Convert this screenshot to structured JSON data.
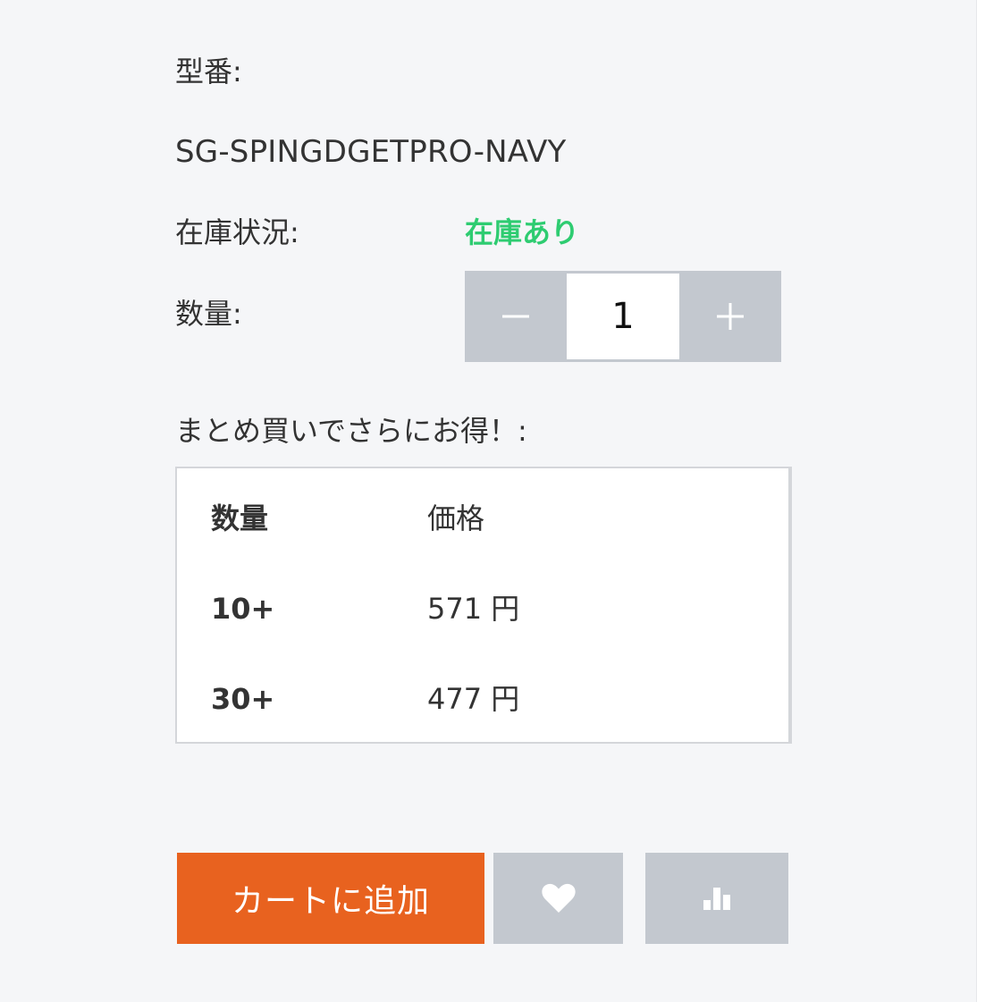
{
  "product": {
    "model_label": "型番:",
    "model_value": "SG-SPINGDGETPRO-NAVY",
    "stock_label": "在庫状況:",
    "stock_value": "在庫あり",
    "quantity_label": "数量:",
    "quantity_value": "1"
  },
  "bulk": {
    "title": "まとめ買いでさらにお得！:",
    "header": {
      "qty": "数量",
      "price": "価格"
    },
    "rows": [
      {
        "qty": "10+",
        "price": "571 円"
      },
      {
        "qty": "30+",
        "price": "477 円"
      }
    ]
  },
  "actions": {
    "add_to_cart_label": "カートに追加",
    "wishlist_icon": "heart-icon",
    "compare_icon": "bar-chart-icon"
  },
  "colors": {
    "stock_green": "#2ecc71",
    "cart_orange": "#e8621f",
    "button_gray": "#c3c8cf",
    "background": "#f5f6f8"
  }
}
